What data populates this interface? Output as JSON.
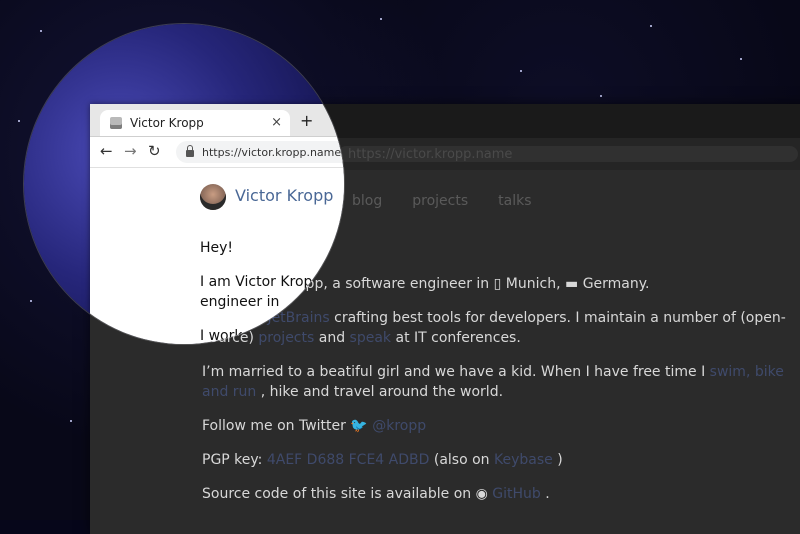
{
  "browser": {
    "tab_title": "Victor Kropp",
    "url": "https://victor.kropp.name"
  },
  "site": {
    "brand_name": "Victor Kropp",
    "nav": [
      {
        "label": "blog"
      },
      {
        "label": "projects"
      },
      {
        "label": "talks"
      }
    ]
  },
  "content": {
    "greeting": "Hey!",
    "intro_prefix": "I am Victor Kropp, a software engineer in ",
    "city_flag": "Munich",
    "country_flag": "Germany",
    "work_prefix": "I work at ",
    "work_company": "JetBrains",
    "work_mid": " crafting best tools for developers. I maintain a number of (open-source) ",
    "work_projects": "projects",
    "work_and": " and ",
    "work_speak": "speak",
    "work_suffix": " at IT conferences.",
    "family_prefix": "I’m married to a beatiful girl and we have a kid. When I have free time I ",
    "family_hobby": "swim, bike and run",
    "family_suffix": ", hike and travel around the world.",
    "twitter_prefix": "Follow me on Twitter ",
    "twitter_handle": "@kropp",
    "pgp_prefix": "PGP key: ",
    "pgp_key": "4AEF D688 FCE4 ADBD",
    "pgp_mid": " (also on ",
    "pgp_keybase": "Keybase",
    "pgp_suffix": ")",
    "source_prefix": "Source code of this site is available on ",
    "source_github": "GitHub",
    "source_suffix": "."
  },
  "icons": [
    "back-icon",
    "forward-icon",
    "reload-icon",
    "lock-icon",
    "close-icon",
    "plus-icon",
    "twitter-icon",
    "github-icon"
  ]
}
